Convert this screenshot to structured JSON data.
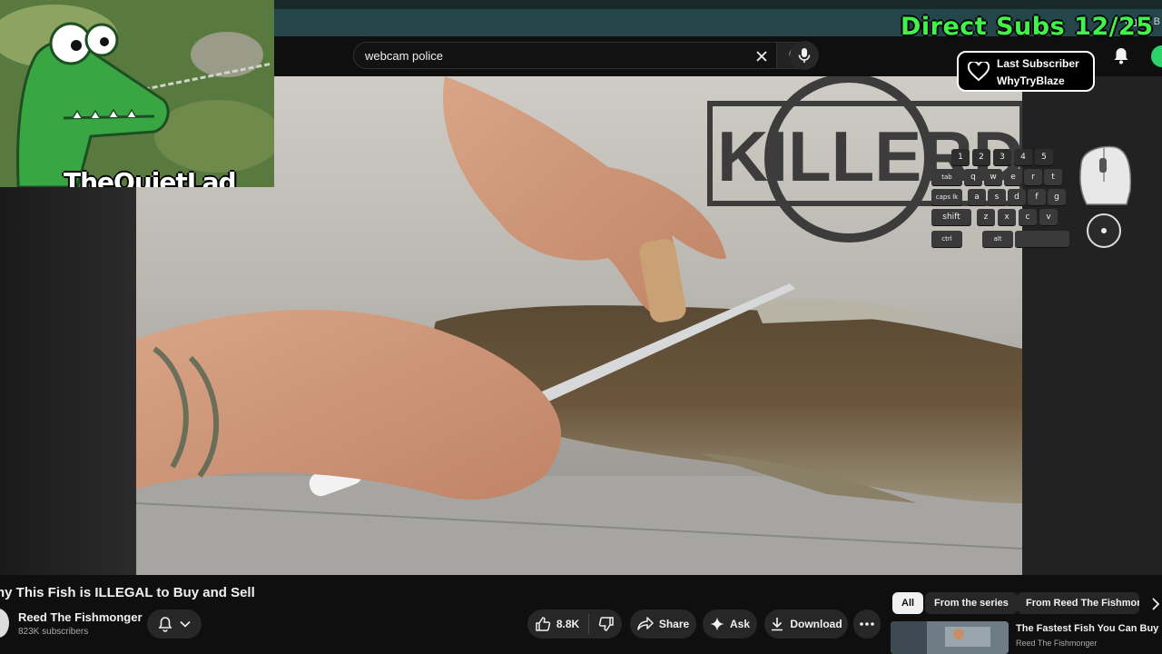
{
  "browser": {
    "bookmarks_label": "All B"
  },
  "header": {
    "search_value": "webcam police"
  },
  "overlays": {
    "direct_subs": "Direct Subs 12/25",
    "last_subscriber_label": "Last Subscriber",
    "last_subscriber_name": "WhyTryBlaze",
    "streamer_name": "TheQuietLad",
    "video_brand": "KILLERDOCK",
    "keyboard": {
      "row1": [
        "1",
        "2",
        "3",
        "4",
        "5"
      ],
      "row2": [
        "tab",
        "q",
        "w",
        "e",
        "r",
        "t"
      ],
      "row3": [
        "caps lk",
        "a",
        "s",
        "d",
        "f",
        "g"
      ],
      "row4": [
        "shift",
        "z",
        "x",
        "c",
        "v"
      ],
      "row5": [
        "ctrl",
        "alt"
      ]
    }
  },
  "video": {
    "title": "hy This Fish is ILLEGAL to Buy and Sell"
  },
  "channel": {
    "name": "Reed The Fishmonger",
    "subscribers": "823K subscribers"
  },
  "actions": {
    "like_count": "8.8K",
    "share": "Share",
    "ask": "Ask",
    "download": "Download"
  },
  "chips": [
    "All",
    "From the series",
    "From Reed The Fishmonger"
  ],
  "recommended": {
    "title": "The Fastest Fish You Can Buy",
    "channel": "Reed The Fishmonger"
  },
  "icons": [
    "folder-icon",
    "close-icon",
    "search-icon",
    "microphone-icon",
    "bell-icon",
    "heart-icon",
    "thumbs-up-icon",
    "thumbs-down-icon",
    "share-icon",
    "sparkle-icon",
    "download-icon",
    "more-icon",
    "chevron-down-icon",
    "chevron-right-icon"
  ],
  "colors": {
    "direct_subs": "#41f24a",
    "chip_selected_bg": "#f1f1f1",
    "pill_bg": "#272727",
    "page_bg": "#0f0f0f"
  }
}
